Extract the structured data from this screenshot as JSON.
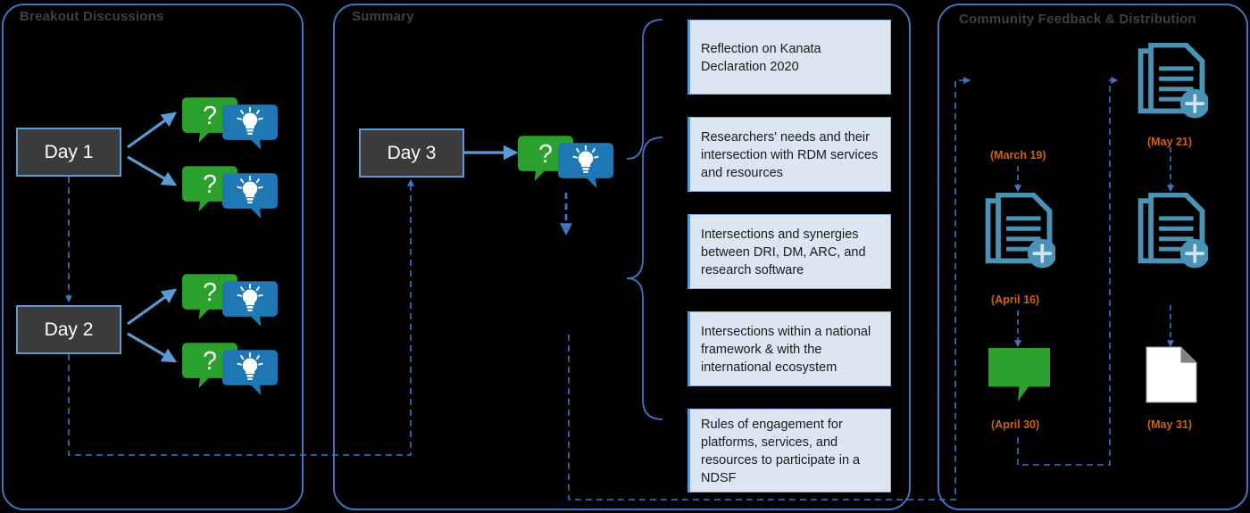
{
  "panels": [
    {
      "id": "breakout",
      "title": "Breakout Discussions"
    },
    {
      "id": "summary",
      "title": "Summary"
    },
    {
      "id": "community",
      "title": "Community Feedback & Distribution"
    }
  ],
  "day_boxes": [
    {
      "label": "Day 1"
    },
    {
      "label": "Day 2"
    },
    {
      "label": "Day 3"
    }
  ],
  "topics": [
    {
      "text": "Reflection on Kanata Declaration 2020"
    },
    {
      "text": "Researchers' needs and their intersection with RDM services and resources"
    },
    {
      "text": "Intersections and synergies between DRI, DM, ARC, and research software"
    },
    {
      "text": "Intersections within a national framework & with the international ecosystem"
    },
    {
      "text": "Rules of engagement for platforms, services, and resources to participate in a NDSF"
    }
  ],
  "milestones": [
    {
      "date": "(March 19)",
      "icon": "document-add-icon"
    },
    {
      "date": "(April 16)",
      "icon": "document-add-icon"
    },
    {
      "date": "(April 30)",
      "icon": "speech-bubble-icon"
    },
    {
      "date": "(May 21)",
      "icon": "document-add-icon"
    },
    {
      "date": "(May 31)",
      "icon": "page-icon"
    }
  ],
  "icons": {
    "question_bubble": "question-speech-bubble-icon",
    "idea_bubble": "lightbulb-speech-bubble-icon",
    "document_add": "document-add-icon",
    "green_bubble": "green-speech-bubble-icon",
    "white_page": "white-page-icon"
  },
  "colors": {
    "background": "#000000",
    "panel_border": "#4472c4",
    "panel_title": "#404040",
    "day_fill": "#3b3b3b",
    "day_border": "#5b9bd5",
    "topic_fill": "#dce6f2",
    "topic_border": "#8faadc",
    "arrow_blue": "#5b9bd5",
    "dashed_blue": "#4472c4",
    "bubble_green": "#2ca02c",
    "bubble_blue": "#1f77b4",
    "doc_teal": "#4a93b5",
    "date_orange": "#d2610c",
    "white": "#ffffff"
  }
}
